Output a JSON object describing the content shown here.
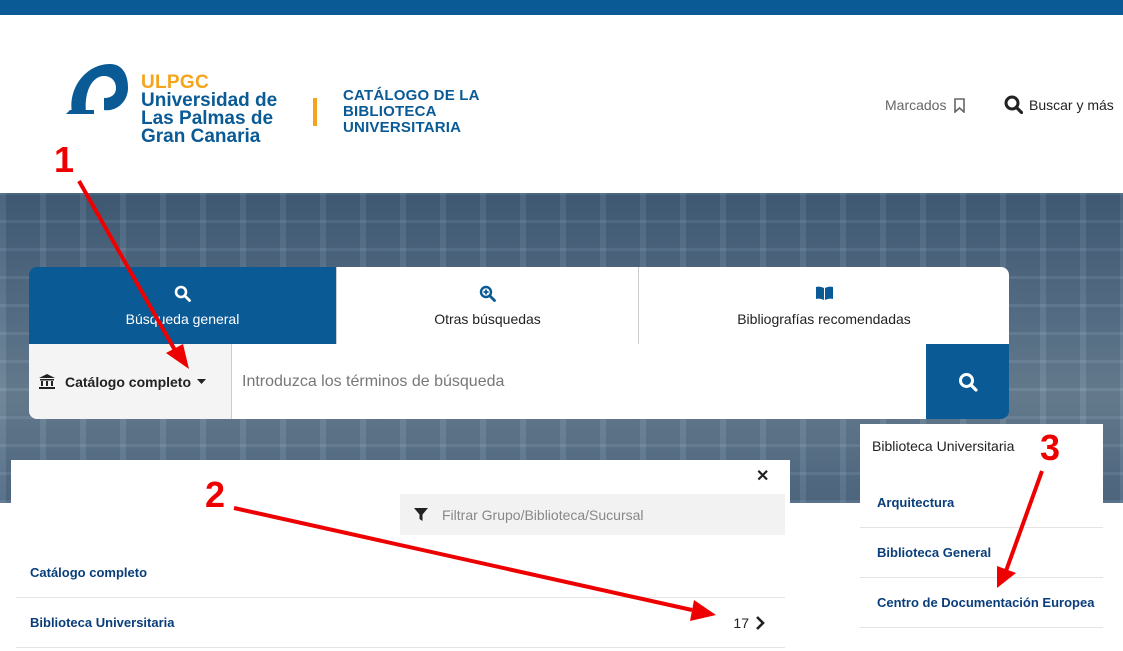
{
  "header": {
    "university_code": "ULPGC",
    "university_name_lines": [
      "Universidad de",
      "Las Palmas de",
      "Gran Canaria"
    ],
    "catalog_title_lines": [
      "CATÁLOGO DE LA",
      "BIBLIOTECA",
      "UNIVERSITARIA"
    ],
    "marcados_label": "Marcados",
    "buscar_label": "Buscar y más"
  },
  "tabs": [
    {
      "label": "Búsqueda general",
      "icon": "search-icon",
      "active": true
    },
    {
      "label": "Otras búsquedas",
      "icon": "zoom-plus-icon",
      "active": false
    },
    {
      "label": "Bibliografías recomendadas",
      "icon": "book-icon",
      "active": false
    }
  ],
  "search": {
    "scope_label": "Catálogo completo",
    "placeholder": "Introduzca los términos de búsqueda"
  },
  "panel": {
    "filter_placeholder": "Filtrar Grupo/Biblioteca/Sucursal",
    "items": [
      {
        "label": "Catálogo completo",
        "count": ""
      },
      {
        "label": "Biblioteca Universitaria",
        "count": "17"
      }
    ]
  },
  "subpanel": {
    "title": "Biblioteca Universitaria",
    "items": [
      {
        "label": "Arquitectura"
      },
      {
        "label": "Biblioteca General"
      },
      {
        "label": "Centro de Documentación Europea"
      }
    ]
  },
  "annotations": [
    "1",
    "2",
    "3"
  ],
  "colors": {
    "primary": "#0a5a96",
    "accent": "#f5a41d",
    "link": "#0a3e7a",
    "annotation": "#ef0000"
  }
}
